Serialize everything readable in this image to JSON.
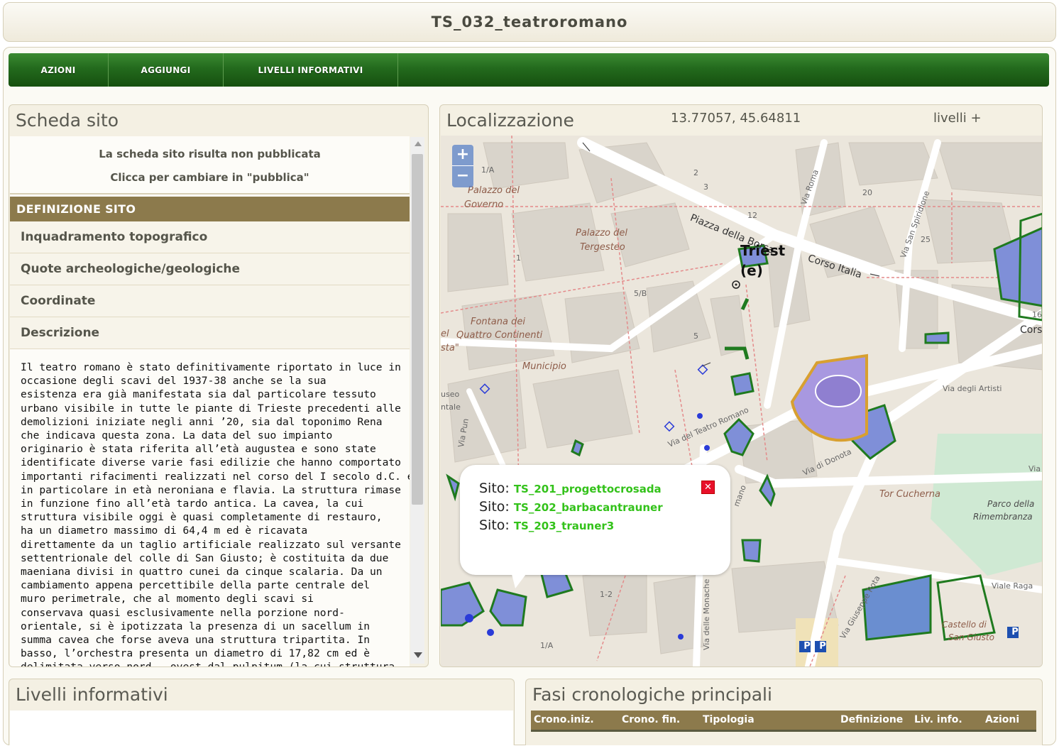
{
  "window": {
    "title": "TS_032_teatroromano"
  },
  "menu": {
    "items": [
      "AZIONI",
      "AGGIUNGI",
      "LIVELLI INFORMATIVI"
    ]
  },
  "scheda": {
    "title": "Scheda sito",
    "pub_status": "La scheda sito risulta non pubblicata",
    "pub_action": "Clicca per cambiare in \"pubblica\"",
    "section_header": "DEFINIZIONE SITO",
    "accordion": [
      "Inquadramento topografico",
      "Quote archeologiche/geologiche",
      "Coordinate",
      "Descrizione"
    ],
    "description_lines": [
      "Il teatro romano è stato definitivamente riportato in luce in",
      "occasione degli scavi del 1937-38 anche se la sua",
      "esistenza era già manifestata sia dal particolare tessuto",
      "urbano visibile in tutte le piante di Trieste precedenti alle",
      "demolizioni iniziate negli anni ’20, sia dal toponimo Rena",
      "che indicava questa zona. La data del suo impianto",
      "originario è stata riferita all’età augustea e sono state",
      "identificate diverse varie fasi edilizie che hanno comportato",
      "importanti rifacimenti realizzati nel corso del I secolo d.C. e",
      "in particolare in età neroniana e flavia. La struttura rimase",
      "in funzione fino all’età tardo antica. La cavea, la cui",
      "struttura visibile oggi è quasi completamente di restauro,",
      "ha un diametro massimo di 64,4 m ed è ricavata",
      "direttamente da un taglio artificiale realizzato sul versante",
      "settentrionale del colle di San Giusto; è costituita da due",
      "maeniana divisi in quattro cunei da cinque scalaria. Da un",
      "cambiamento appena percettibile della parte centrale del",
      "muro perimetrale, che al momento degli scavi si",
      "conservava quasi esclusivamente nella porzione nord-",
      "orientale, si è ipotizzata la presenza di un sacellum in",
      "summa cavea che forse aveva una struttura tripartita. In",
      "basso, l’orchestra presenta un diametro di 17,82 cm ed è",
      "delimitata verso nord - ovest dal pulpitum (la cui struttura"
    ]
  },
  "localizzazione": {
    "title": "Localizzazione",
    "coords": "13.77057, 45.64811",
    "layers_button": "livelli +",
    "zoom_in": "+",
    "zoom_out": "−",
    "popup": {
      "label": "Sito:",
      "links": [
        "TS_201_progettocrosada",
        "TS_202_barbacantrauner",
        "TS_203_trauner3"
      ],
      "close": "✕"
    },
    "map_labels": {
      "palazzo_governo_1": "Palazzo del",
      "palazzo_governo_2": "Governo",
      "palazzo_tergesteo_1": "Palazzo del",
      "palazzo_tergesteo_2": "Tergesteo",
      "fontana_1": "Fontana dei",
      "fontana_2": "Quattro Continenti",
      "municipio": "Municipio",
      "piazza_borsa": "Piazza della Borsa",
      "corso_italia": "Corso Italia",
      "via_roma": "Via Roma",
      "via_san_spiridione": "Via San Spiridione",
      "via_teatro_romano": "Via del Teatro Romano",
      "via_degli_artisti": "Via degli Artisti",
      "via_donota": "Via di Donota",
      "tor_cucherna": "Tor Cucherna",
      "parco_1": "Parco della",
      "parco_2": "Rimembranza",
      "via_giuseppe_rota": "Via Giuseppe Rota",
      "via_delle_monache": "Via delle Monache",
      "viale_ragusa": "Viale Raga",
      "castello_1": "Castello di",
      "castello_2": "San Giusto",
      "trieste": "Triest",
      "trieste_e": "(e)",
      "via_punta": "Via Pun",
      "museo": "useo",
      "ntale": "ntale",
      "el": "el",
      "sta": "sta\"",
      "cors": "Cors",
      "via_right": "Via",
      "mano": "mano",
      "parking": "P",
      "house_numbers": [
        "1/A",
        "2",
        "3",
        "12",
        "20",
        "25",
        "16",
        "5/B",
        "5",
        "1",
        "1/A",
        "1-2"
      ]
    }
  },
  "livelli": {
    "title": "Livelli informativi"
  },
  "fasi": {
    "title": "Fasi cronologiche principali",
    "columns": [
      "Crono.iniz.",
      "Crono. fin.",
      "Tipologia",
      "Definizione",
      "Liv. info.",
      "Azioni"
    ]
  },
  "colors": {
    "menu_green": "#236a1d",
    "section_brown": "#8c7a4c",
    "link_green": "#33c21a",
    "map_bg": "#ebe6dc",
    "site_fill": "#7f8fd8",
    "site_outline": "#1f7a1f",
    "theatre_fill": "#a898e0",
    "theatre_outline": "#d8a030"
  }
}
